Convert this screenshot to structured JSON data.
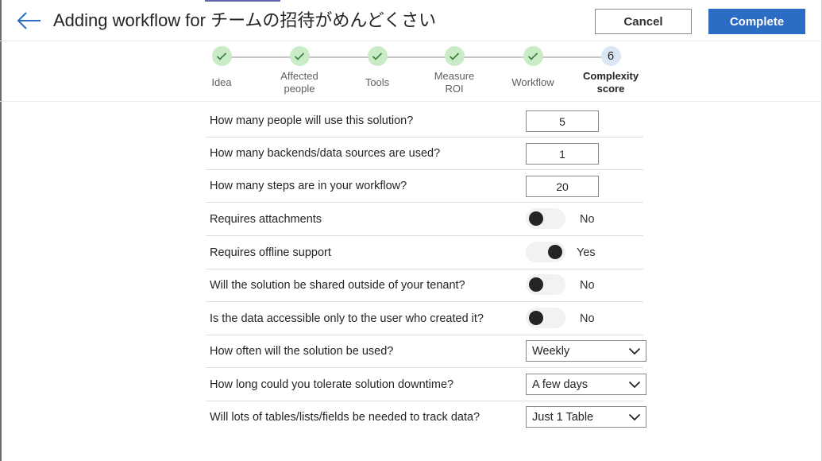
{
  "header": {
    "title": "Adding workflow for チームの招待がめんどくさい",
    "cancel_label": "Cancel",
    "complete_label": "Complete",
    "back_icon": "back-arrow-icon",
    "accent_color": "#2b6cc4"
  },
  "stepper": {
    "steps": [
      {
        "label": "Idea",
        "status": "done"
      },
      {
        "label": "Affected people",
        "status": "done"
      },
      {
        "label": "Tools",
        "status": "done"
      },
      {
        "label": "Measure ROI",
        "status": "done"
      },
      {
        "label": "Workflow",
        "status": "done"
      },
      {
        "label": "Complexity score",
        "status": "current",
        "number": "6"
      }
    ],
    "done_color": "#c9ecc7",
    "current_color": "#dce7f5"
  },
  "questions": [
    {
      "text": "How many people will use this solution?",
      "type": "number",
      "value": "5"
    },
    {
      "text": "How many backends/data sources are  used?",
      "type": "number",
      "value": "1"
    },
    {
      "text": "How many steps are in your workflow?",
      "type": "number",
      "value": "20"
    },
    {
      "text": "Requires attachments",
      "type": "toggle",
      "on": false,
      "value": "No"
    },
    {
      "text": "Requires offline support",
      "type": "toggle",
      "on": true,
      "value": "Yes"
    },
    {
      "text": "Will the solution be shared  outside of your tenant?",
      "type": "toggle",
      "on": false,
      "value": "No"
    },
    {
      "text": "Is the data accessible only to the user who created it?",
      "type": "toggle",
      "on": false,
      "value": "No"
    },
    {
      "text": "How often will the solution be used?",
      "type": "dropdown",
      "value": "Weekly"
    },
    {
      "text": "How long could you tolerate solution downtime?",
      "type": "dropdown",
      "value": "A few days"
    },
    {
      "text": "Will lots of tables/lists/fields be needed to track data?",
      "type": "dropdown",
      "value": "Just 1 Table"
    }
  ]
}
